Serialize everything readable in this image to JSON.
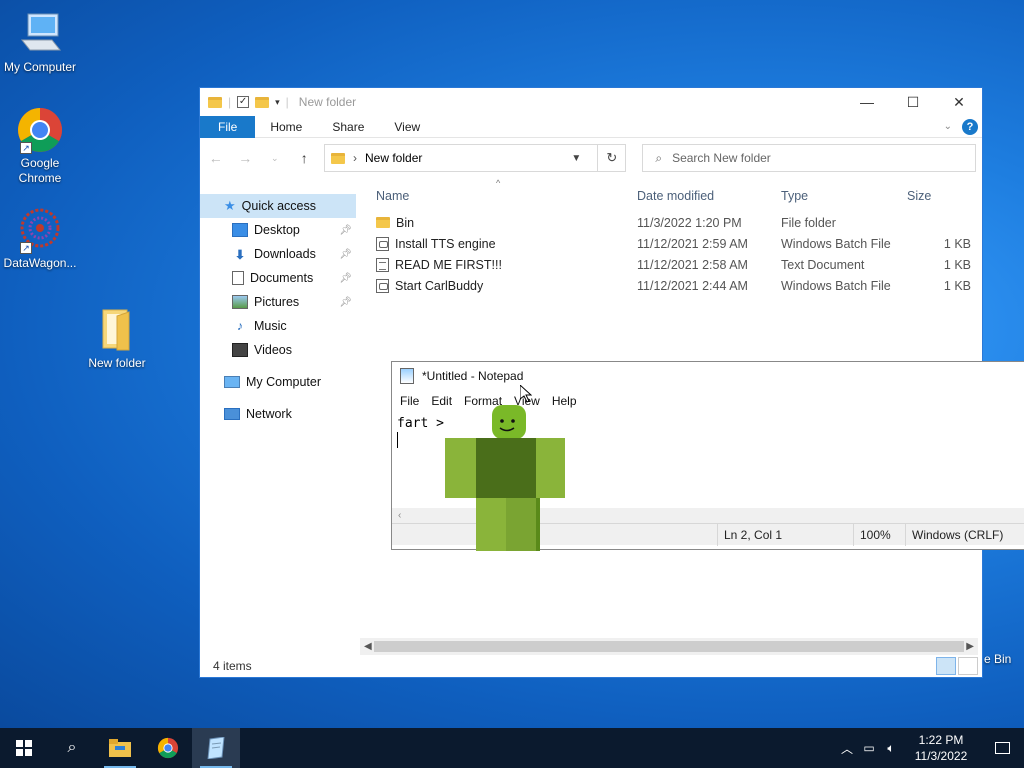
{
  "desktop": {
    "icons": [
      {
        "label": "My Computer"
      },
      {
        "label": "Google Chrome"
      },
      {
        "label": "DataWagon..."
      },
      {
        "label": "New folder"
      }
    ],
    "recycle_bin_partial": "e Bin"
  },
  "explorer": {
    "title": "New folder",
    "ribbon_tabs": [
      "File",
      "Home",
      "Share",
      "View"
    ],
    "address": "New folder",
    "search_placeholder": "Search New folder",
    "nav": {
      "quick_access": "Quick access",
      "items": [
        "Desktop",
        "Downloads",
        "Documents",
        "Pictures",
        "Music",
        "Videos"
      ],
      "my_computer": "My Computer",
      "network": "Network"
    },
    "columns": {
      "name": "Name",
      "date": "Date modified",
      "type": "Type",
      "size": "Size"
    },
    "files": [
      {
        "name": "Bin",
        "date": "11/3/2022 1:20 PM",
        "type": "File folder",
        "size": "",
        "icon": "folder-icon"
      },
      {
        "name": "Install TTS engine",
        "date": "11/12/2021 2:59 AM",
        "type": "Windows Batch File",
        "size": "1 KB",
        "icon": "batch-file-icon"
      },
      {
        "name": "READ ME FIRST!!!",
        "date": "11/12/2021 2:58 AM",
        "type": "Text Document",
        "size": "1 KB",
        "icon": "text-file-icon"
      },
      {
        "name": "Start CarlBuddy",
        "date": "11/12/2021 2:44 AM",
        "type": "Windows Batch File",
        "size": "1 KB",
        "icon": "batch-file-icon"
      }
    ],
    "status": "4 items"
  },
  "notepad": {
    "title": "*Untitled - Notepad",
    "menu": [
      "File",
      "Edit",
      "Format",
      "View",
      "Help"
    ],
    "text": "fart >",
    "status": {
      "position": "Ln 2, Col 1",
      "zoom": "100%",
      "eol": "Windows (CRLF)"
    }
  },
  "taskbar": {
    "time": "1:22 PM",
    "date": "11/3/2022"
  }
}
